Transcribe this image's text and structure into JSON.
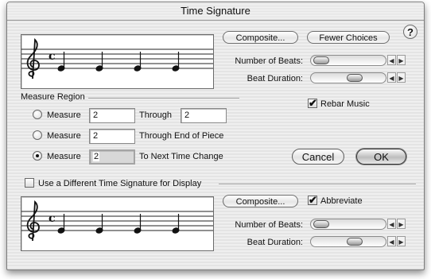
{
  "window": {
    "title": "Time Signature"
  },
  "top": {
    "composite_button": "Composite...",
    "fewer_choices_button": "Fewer Choices",
    "help_glyph": "?",
    "beats_label": "Number of Beats:",
    "duration_label": "Beat Duration:",
    "beats_slider_level": 0.05,
    "duration_slider_level": 0.5
  },
  "measure_region": {
    "label": "Measure Region",
    "rows": [
      {
        "radio_label": "Measure",
        "value": "2",
        "suffix_label": "Through",
        "through_value": "2",
        "selected": false
      },
      {
        "radio_label": "Measure",
        "value": "2",
        "suffix_label": "Through End of Piece",
        "selected": false
      },
      {
        "radio_label": "Measure",
        "value": "2",
        "suffix_label": "To Next Time Change",
        "selected": true
      }
    ]
  },
  "rebar": {
    "label": "Rebar Music",
    "checked": true
  },
  "buttons": {
    "cancel": "Cancel",
    "ok": "OK"
  },
  "display": {
    "checkbox_label": "Use a Different Time Signature for Display",
    "checked": false,
    "composite_button": "Composite...",
    "abbreviate_label": "Abbreviate",
    "abbreviate_checked": true,
    "beats_label": "Number of Beats:",
    "duration_label": "Beat Duration:",
    "beats_slider_level": 0.05,
    "duration_slider_level": 0.5
  },
  "notation": {
    "time_symbol": "c",
    "clef": "treble",
    "notes_per_staff": 4
  },
  "colors": {
    "dialog_bg": "#ececec",
    "staff_bg": "#ffffff",
    "default_button": "#bdbdbd"
  }
}
